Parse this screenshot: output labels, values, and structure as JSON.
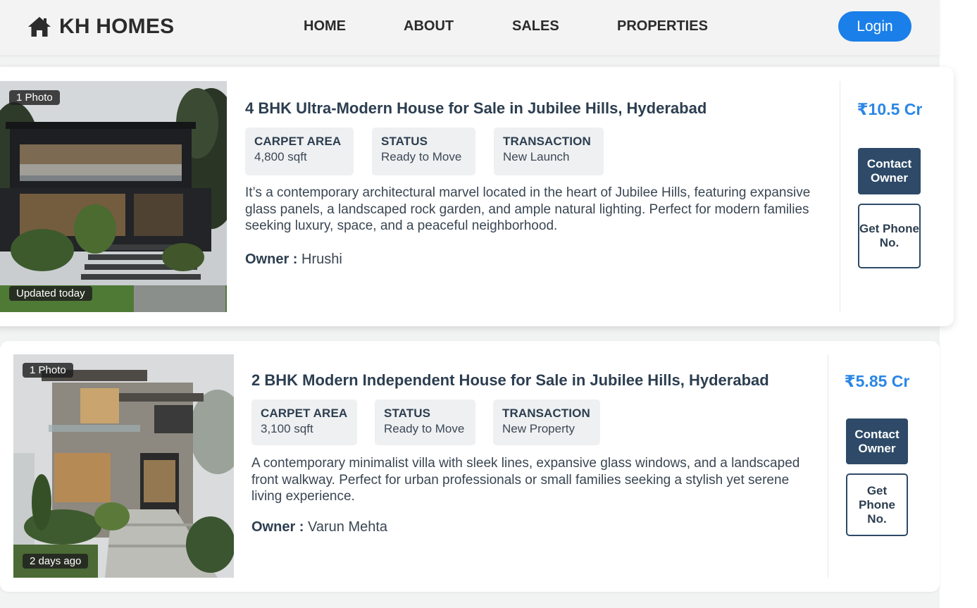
{
  "navbar": {
    "brand": "KH HOMES",
    "brand_icon": "home-icon",
    "links": [
      "HOME",
      "ABOUT",
      "SALES",
      "PROPERTIES"
    ],
    "login_label": "Login",
    "accent": "#1a7fe8"
  },
  "listings": [
    {
      "photo_count": "1 Photo",
      "updated": "Updated today",
      "title": "4 BHK Ultra-Modern House for Sale in Jubilee Hills, Hyderabad",
      "specs": [
        {
          "label": "CARPET AREA",
          "value": "4,800 sqft"
        },
        {
          "label": "STATUS",
          "value": "Ready to Move"
        },
        {
          "label": "TRANSACTION",
          "value": "New Launch"
        }
      ],
      "description": "It’s a contemporary architectural marvel located in the heart of Jubilee Hills, featuring expansive glass panels, a landscaped rock garden, and ample natural lighting. Perfect for modern families seeking luxury, space, and a peaceful neighborhood.",
      "owner_label": "Owner :",
      "owner": "Hrushi",
      "price": "₹10.5 Cr",
      "contact_label": "Contact Owner",
      "phone_label": "Get Phone No."
    },
    {
      "photo_count": "1 Photo",
      "updated": "2 days ago",
      "title": "2 BHK Modern Independent House for Sale in Jubilee Hills, Hyderabad",
      "specs": [
        {
          "label": "CARPET AREA",
          "value": "3,100 sqft"
        },
        {
          "label": "STATUS",
          "value": "Ready to Move"
        },
        {
          "label": "TRANSACTION",
          "value": "New Property"
        }
      ],
      "description": "A contemporary minimalist villa with sleek lines, expansive glass windows, and a landscaped front walkway. Perfect for urban professionals or small families seeking a stylish yet serene living experience.",
      "owner_label": "Owner :",
      "owner": "Varun Mehta",
      "price": "₹5.85 Cr",
      "contact_label": "Contact Owner",
      "phone_label": "Get Phone No."
    }
  ],
  "colors": {
    "price": "#2b86e5",
    "contact_button": "#2e4a68"
  }
}
